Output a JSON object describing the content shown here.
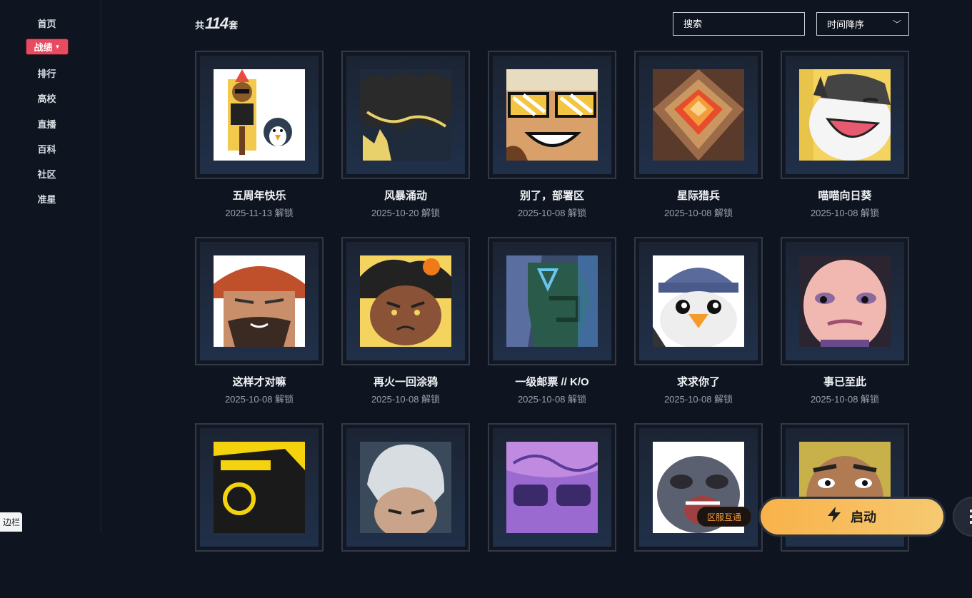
{
  "sidebar": {
    "items": [
      {
        "label": "首页"
      },
      {
        "label": "战绩",
        "active": true
      },
      {
        "label": "排行"
      },
      {
        "label": "高校"
      },
      {
        "label": "直播"
      },
      {
        "label": "百科"
      },
      {
        "label": "社区"
      },
      {
        "label": "准星"
      }
    ],
    "toggle_label": "边栏"
  },
  "header": {
    "count_prefix": "共",
    "count_value": "114",
    "count_suffix": "套",
    "search_placeholder": "搜索",
    "sort_label": "时间降序"
  },
  "cards": [
    {
      "name": "五周年快乐",
      "date": "2025-11-13 解锁",
      "art": "bear-penguin-sticker"
    },
    {
      "name": "风暴涌动",
      "date": "2025-10-20 解锁",
      "art": "storm-crown"
    },
    {
      "name": "别了，部署区",
      "date": "2025-10-08 解锁",
      "art": "sunglasses-grin"
    },
    {
      "name": "星际猎兵",
      "date": "2025-10-08 解锁",
      "art": "orange-gem-shield"
    },
    {
      "name": "喵喵向日葵",
      "date": "2025-10-08 解锁",
      "art": "laughing-cat"
    },
    {
      "name": "这样才对嘛",
      "date": "2025-10-08 解锁",
      "art": "bearded-warrior"
    },
    {
      "name": "再火一回涂鸦",
      "date": "2025-10-08 解锁",
      "art": "angry-flower-girl"
    },
    {
      "name": "一级邮票 // K/O",
      "date": "2025-10-08 解锁",
      "art": "cyber-armor"
    },
    {
      "name": "求求你了",
      "date": "2025-10-08 解锁",
      "art": "beanie-penguin"
    },
    {
      "name": "事已至此",
      "date": "2025-10-08 解锁",
      "art": "makeup-face"
    },
    {
      "name": "",
      "date": "",
      "art": "yellow-robot"
    },
    {
      "name": "",
      "date": "",
      "art": "white-hair-girl"
    },
    {
      "name": "",
      "date": "",
      "art": "purple-shades"
    },
    {
      "name": "",
      "date": "",
      "art": "roaring-sloth"
    },
    {
      "name": "",
      "date": "",
      "art": "smirking-man"
    }
  ],
  "footer": {
    "region_label": "区服互通",
    "launch_label": "启动",
    "launch_icon": "lightning-bolt-icon"
  },
  "colors": {
    "background": "#0f1520",
    "accent_active": "#e84a5f",
    "launch_gradient_start": "#f9b24a",
    "launch_gradient_end": "#f6c971",
    "region_text": "#f39a3c"
  }
}
